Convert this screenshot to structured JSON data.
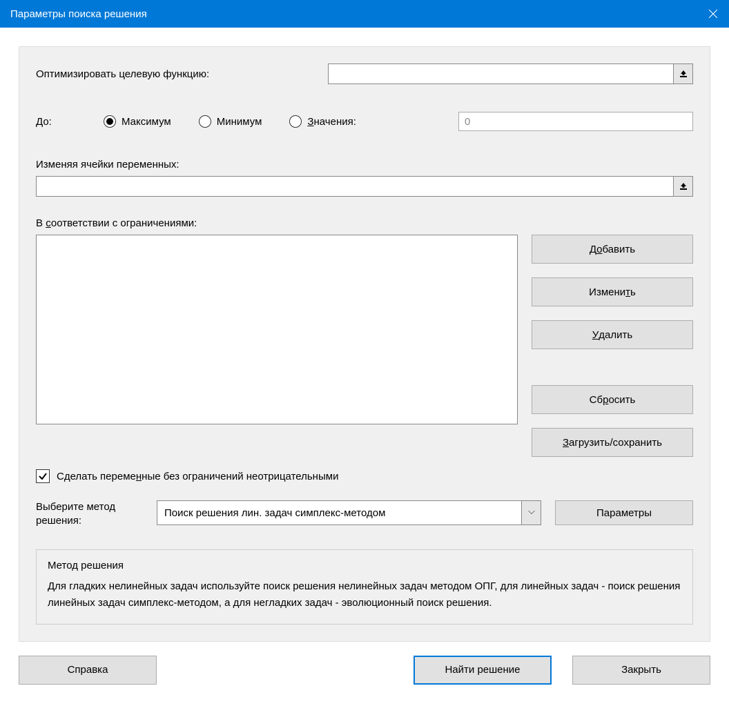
{
  "titlebar": {
    "title": "Параметры поиска решения"
  },
  "objective": {
    "label": "Оптимизировать целевую функцию:",
    "value": ""
  },
  "to": {
    "label": "До:",
    "options": {
      "max": "Максимум",
      "min": "Минимум",
      "value_prefix": "З",
      "value_rest": "начения:"
    },
    "selected": "max",
    "value_input": "0"
  },
  "vars": {
    "label": "Изменяя ячейки переменных:",
    "value": ""
  },
  "constraints": {
    "label_prefix": "В ",
    "label_u": "с",
    "label_rest": "оответствии с ограничениями:",
    "buttons": {
      "add_prefix": "Д",
      "add_u": "о",
      "add_rest": "бавить",
      "change_prefix": "Измени",
      "change_u": "т",
      "change_rest": "ь",
      "delete_prefix": "",
      "delete_u": "У",
      "delete_rest": "далить",
      "reset_prefix": "Сб",
      "reset_u": "р",
      "reset_rest": "осить",
      "loadsave_prefix": "",
      "loadsave_u": "З",
      "loadsave_rest": "агрузить/сохранить"
    }
  },
  "nonneg": {
    "checked": true,
    "label_prefix": "Сделать переме",
    "label_u": "н",
    "label_rest": "ные без ограничений неотрицательными"
  },
  "method": {
    "label": "Выберите метод решения:",
    "selected": "Поиск решения лин. задач симплекс-методом",
    "params_btn": "Параметры"
  },
  "help_box": {
    "title": "Метод решения",
    "body": "Для гладких нелинейных задач используйте поиск решения нелинейных задач методом ОПГ, для линейных задач - поиск решения линейных задач симплекс-методом, а для негладких задач - эволюционный поиск решения."
  },
  "footer": {
    "help": "Справка",
    "solve": "Найти решение",
    "close": "Закрыть"
  }
}
